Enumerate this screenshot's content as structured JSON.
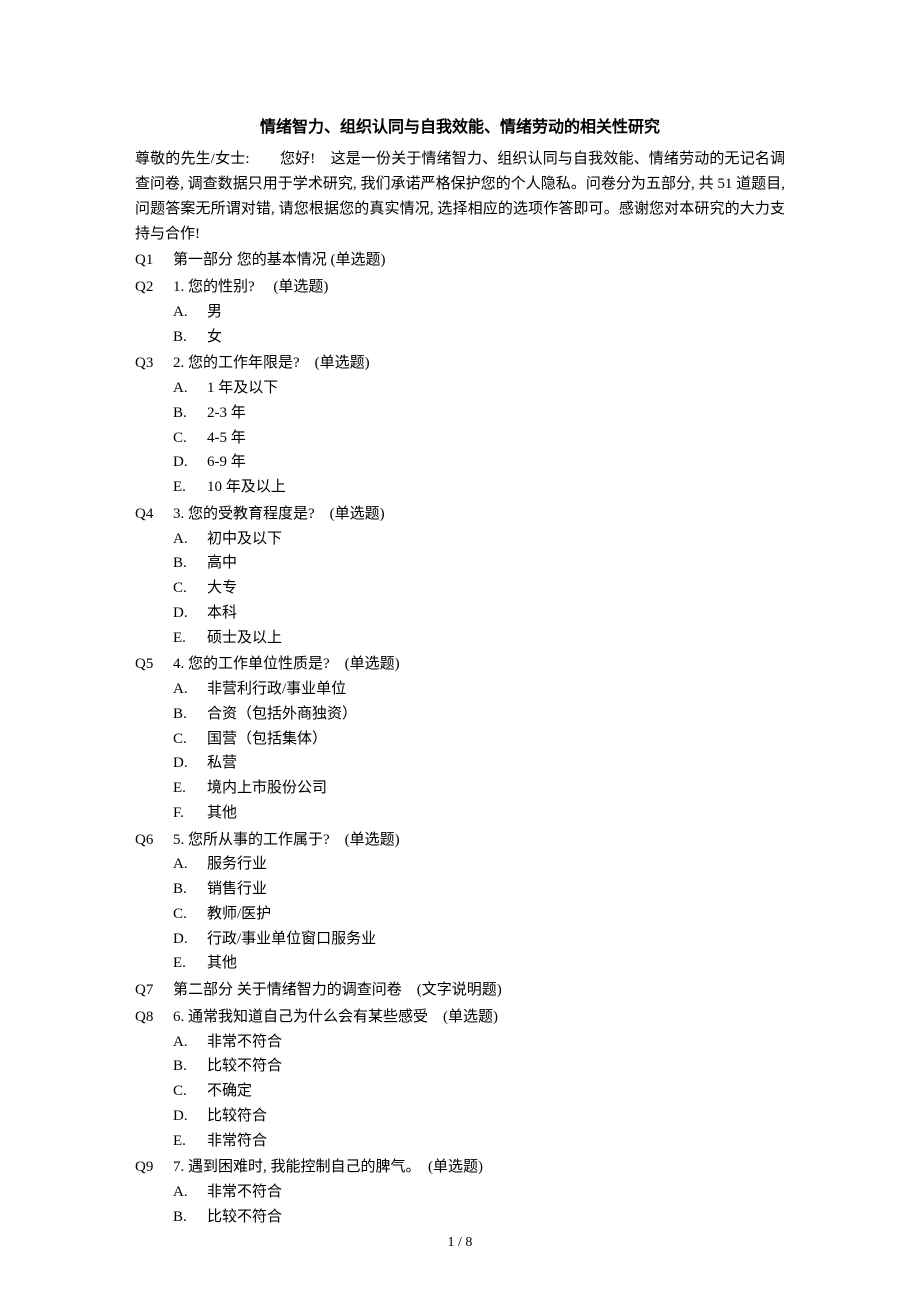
{
  "title": "情绪智力、组织认同与自我效能、情绪劳动的相关性研究",
  "intro": "尊敬的先生/女士:　　您好!　这是一份关于情绪智力、组织认同与自我效能、情绪劳动的无记名调查问卷, 调查数据只用于学术研究, 我们承诺严格保护您的个人隐私。问卷分为五部分, 共 51 道题目, 问题答案无所谓对错, 请您根据您的真实情况, 选择相应的选项作答即可。感谢您对本研究的大力支持与合作!",
  "questions": [
    {
      "num": "Q1",
      "text": "第一部分 您的基本情况  (单选题)",
      "options": []
    },
    {
      "num": "Q2",
      "text": "1. 您的性别?　 (单选题)",
      "options": [
        {
          "letter": "A.",
          "text": "男"
        },
        {
          "letter": "B.",
          "text": "女"
        }
      ]
    },
    {
      "num": "Q3",
      "text": "2. 您的工作年限是?　(单选题)",
      "options": [
        {
          "letter": "A.",
          "text": "1 年及以下"
        },
        {
          "letter": "B.",
          "text": "2-3 年"
        },
        {
          "letter": "C.",
          "text": "4-5 年"
        },
        {
          "letter": "D.",
          "text": "6-9 年"
        },
        {
          "letter": "E.",
          "text": "10 年及以上"
        }
      ]
    },
    {
      "num": "Q4",
      "text": "3. 您的受教育程度是?　(单选题)",
      "options": [
        {
          "letter": "A.",
          "text": "初中及以下"
        },
        {
          "letter": "B.",
          "text": "高中"
        },
        {
          "letter": "C.",
          "text": "大专"
        },
        {
          "letter": "D.",
          "text": "本科"
        },
        {
          "letter": "E.",
          "text": "硕士及以上"
        }
      ]
    },
    {
      "num": "Q5",
      "text": "4. 您的工作单位性质是?　(单选题)",
      "options": [
        {
          "letter": "A.",
          "text": "非营利行政/事业单位"
        },
        {
          "letter": "B.",
          "text": "合资（包括外商独资）"
        },
        {
          "letter": "C.",
          "text": "国营（包括集体）"
        },
        {
          "letter": "D.",
          "text": "私营"
        },
        {
          "letter": "E.",
          "text": "境内上市股份公司"
        },
        {
          "letter": "F.",
          "text": "其他"
        }
      ]
    },
    {
      "num": "Q6",
      "text": "5. 您所从事的工作属于?　(单选题)",
      "options": [
        {
          "letter": "A.",
          "text": "服务行业"
        },
        {
          "letter": "B.",
          "text": "销售行业"
        },
        {
          "letter": "C.",
          "text": "教师/医护"
        },
        {
          "letter": "D.",
          "text": "行政/事业单位窗口服务业"
        },
        {
          "letter": "E.",
          "text": "其他"
        }
      ]
    },
    {
      "num": "Q7",
      "text": "第二部分 关于情绪智力的调查问卷　(文字说明题)",
      "options": []
    },
    {
      "num": "Q8",
      "text": "6. 通常我知道自己为什么会有某些感受　(单选题)",
      "options": [
        {
          "letter": "A.",
          "text": "非常不符合"
        },
        {
          "letter": "B.",
          "text": "比较不符合"
        },
        {
          "letter": "C.",
          "text": "不确定"
        },
        {
          "letter": "D.",
          "text": "比较符合"
        },
        {
          "letter": "E.",
          "text": "非常符合"
        }
      ]
    },
    {
      "num": "Q9",
      "text": "7. 遇到困难时, 我能控制自己的脾气。　(单选题)",
      "options": [
        {
          "letter": "A.",
          "text": "非常不符合"
        },
        {
          "letter": "B.",
          "text": "比较不符合"
        }
      ]
    }
  ],
  "footer": "1 / 8"
}
